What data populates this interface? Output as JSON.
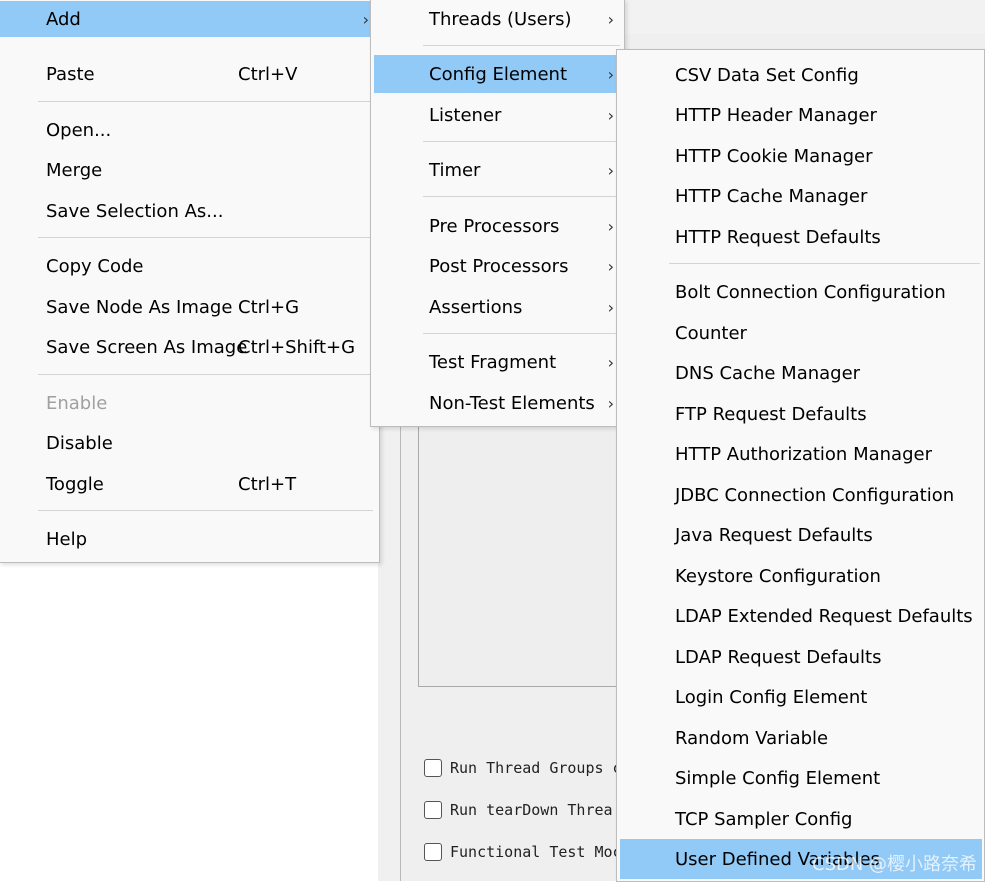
{
  "context_menu": {
    "items": [
      {
        "label": "Add",
        "shortcut": "",
        "submenu": true,
        "highlighted": true
      },
      {
        "label": "Paste",
        "shortcut": "Ctrl+V"
      },
      {
        "label": "Open...",
        "shortcut": ""
      },
      {
        "label": "Merge",
        "shortcut": ""
      },
      {
        "label": "Save Selection As...",
        "shortcut": ""
      },
      {
        "label": "Copy Code",
        "shortcut": ""
      },
      {
        "label": "Save Node As Image",
        "shortcut": "Ctrl+G"
      },
      {
        "label": "Save Screen As Image",
        "shortcut": "Ctrl+Shift+G"
      },
      {
        "label": "Enable",
        "shortcut": "",
        "disabled": true
      },
      {
        "label": "Disable",
        "shortcut": ""
      },
      {
        "label": "Toggle",
        "shortcut": "Ctrl+T"
      },
      {
        "label": "Help",
        "shortcut": ""
      }
    ]
  },
  "add_submenu": {
    "items": [
      {
        "label": "Threads (Users)"
      },
      {
        "label": "Config Element",
        "highlighted": true
      },
      {
        "label": "Listener"
      },
      {
        "label": "Timer"
      },
      {
        "label": "Pre Processors"
      },
      {
        "label": "Post Processors"
      },
      {
        "label": "Assertions"
      },
      {
        "label": "Test Fragment"
      },
      {
        "label": "Non-Test Elements"
      }
    ],
    "arrow": "›"
  },
  "config_submenu": {
    "items": [
      {
        "label": "CSV Data Set Config"
      },
      {
        "label": "HTTP Header Manager"
      },
      {
        "label": "HTTP Cookie Manager"
      },
      {
        "label": "HTTP Cache Manager"
      },
      {
        "label": "HTTP Request Defaults"
      },
      {
        "label": "Bolt Connection Configuration"
      },
      {
        "label": "Counter"
      },
      {
        "label": "DNS Cache Manager"
      },
      {
        "label": "FTP Request Defaults"
      },
      {
        "label": "HTTP Authorization Manager"
      },
      {
        "label": "JDBC Connection Configuration"
      },
      {
        "label": "Java Request Defaults"
      },
      {
        "label": "Keystore Configuration"
      },
      {
        "label": "LDAP Extended Request Defaults"
      },
      {
        "label": "LDAP Request Defaults"
      },
      {
        "label": "Login Config Element"
      },
      {
        "label": "Random Variable"
      },
      {
        "label": "Simple Config Element"
      },
      {
        "label": "TCP Sampler Config"
      },
      {
        "label": "User Defined Variables",
        "highlighted": true
      }
    ]
  },
  "background_panel": {
    "checkboxes": [
      {
        "label": "Run Thread Groups c",
        "checked": false
      },
      {
        "label": "Run tearDown Threa",
        "checked": false
      },
      {
        "label": "Functional Test Moc",
        "checked": false
      }
    ]
  },
  "watermark": "CSDN @樱小路奈希",
  "colors": {
    "highlight": "#91c9f7",
    "menu_bg": "#f9f9f9",
    "disabled_text": "#a0a0a0"
  }
}
